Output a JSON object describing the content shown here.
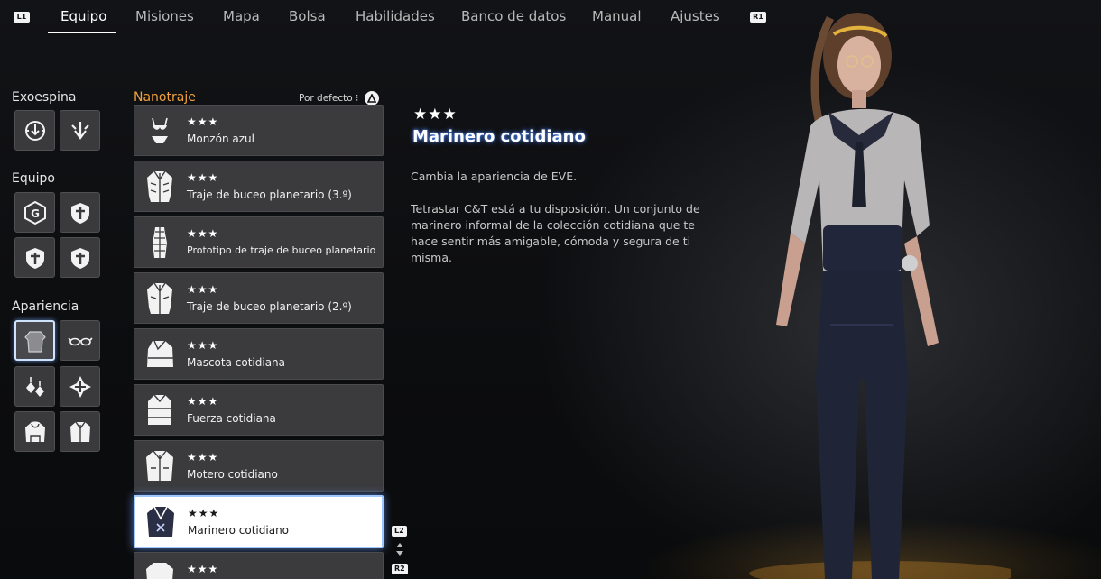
{
  "nav": {
    "left_button": "L1",
    "right_button": "R1",
    "tabs": [
      "Equipo",
      "Misiones",
      "Mapa",
      "Bolsa",
      "Habilidades",
      "Banco de datos",
      "Manual",
      "Ajustes"
    ],
    "active_tab": "Equipo"
  },
  "sidebar": {
    "exospine_title": "Exoespina",
    "gear_title": "Equipo",
    "gear_slot_letter": "G",
    "appearance_title": "Apariencia"
  },
  "list": {
    "title": "Nanotraje",
    "sort_label": "Por defecto",
    "items": [
      {
        "stars": "★★★",
        "name": "Monzón azul",
        "icon": "swimsuit-icon"
      },
      {
        "stars": "★★★",
        "name": "Traje de buceo planetario (3.º)",
        "icon": "diving-suit-icon"
      },
      {
        "stars": "★★★",
        "name": "Prototipo de traje de buceo planetario",
        "icon": "bodysuit-icon"
      },
      {
        "stars": "★★★",
        "name": "Traje de buceo planetario (2.º)",
        "icon": "diving-suit-icon"
      },
      {
        "stars": "★★★",
        "name": "Mascota cotidiana",
        "icon": "casual-outfit-icon"
      },
      {
        "stars": "★★★",
        "name": "Fuerza cotidiana",
        "icon": "casual-outfit-icon"
      },
      {
        "stars": "★★★",
        "name": "Motero cotidiano",
        "icon": "jacket-icon"
      },
      {
        "stars": "★★★",
        "name": "Marinero cotidiano",
        "icon": "sailor-outfit-icon"
      },
      {
        "stars": "★★★",
        "name": "",
        "icon": "outfit-icon"
      }
    ],
    "selected_index": 7,
    "page_up_button": "L2",
    "page_down_button": "R2"
  },
  "detail": {
    "stars": "★★★",
    "title": "Marinero cotidiano",
    "summary": "Cambia la apariencia de EVE.",
    "description": "Tetrastar C&T está a tu disposición. Un conjunto de marinero informal de la colección cotidiana que te hace sentir más amigable, cómoda y segura de ti misma."
  },
  "colors": {
    "accent_orange": "#f0a23c",
    "selection_glow": "#9fc6ff",
    "item_bg": "#3b3b3d"
  }
}
